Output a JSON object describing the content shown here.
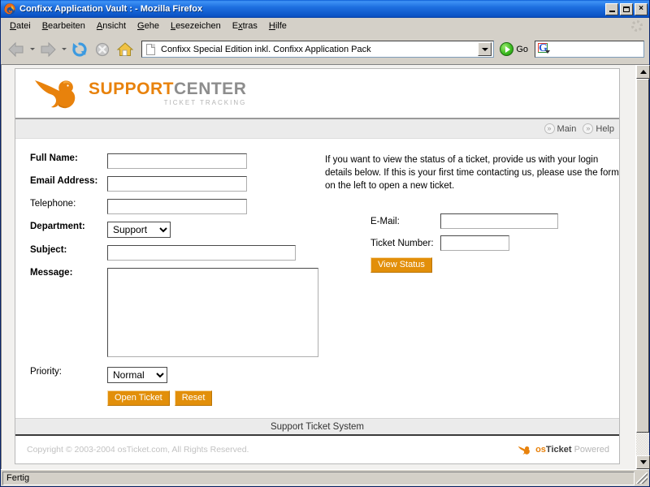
{
  "window": {
    "title": "Confixx Application Vault : - Mozilla Firefox",
    "app_icon": "firefox-icon",
    "minimize_label": "",
    "maximize_label": "",
    "close_label": "×"
  },
  "menubar": {
    "items": [
      {
        "label": "Datei",
        "accel": "D"
      },
      {
        "label": "Bearbeiten",
        "accel": "B"
      },
      {
        "label": "Ansicht",
        "accel": "A"
      },
      {
        "label": "Gehe",
        "accel": "G"
      },
      {
        "label": "Lesezeichen",
        "accel": "L"
      },
      {
        "label": "Extras",
        "accel": "x"
      },
      {
        "label": "Hilfe",
        "accel": "H"
      }
    ]
  },
  "toolbar": {
    "back_icon": "back-arrow-icon",
    "forward_icon": "forward-arrow-icon",
    "reload_icon": "reload-icon",
    "stop_icon": "stop-icon",
    "home_icon": "home-icon",
    "address_value": "Confixx Special Edition inkl. Confixx Application Pack",
    "address_placeholder": "",
    "go_label": "Go",
    "search_value": "",
    "search_placeholder": "",
    "search_engine_icon": "google-g-icon"
  },
  "page": {
    "logo": {
      "icon": "kangaroo-icon",
      "primary": "SUPPORT",
      "secondary": "CENTER",
      "tagline": "TICKET TRACKING"
    },
    "nav": [
      {
        "icon": "double-chevron-icon",
        "label": "Main"
      },
      {
        "icon": "double-chevron-icon",
        "label": "Help"
      }
    ],
    "new_ticket_form": {
      "fields": [
        {
          "label": "Full Name:",
          "required": true,
          "value": "",
          "placeholder": ""
        },
        {
          "label": "Email Address:",
          "required": true,
          "value": "",
          "placeholder": ""
        },
        {
          "label": "Telephone:",
          "required": false,
          "value": "",
          "placeholder": ""
        }
      ],
      "department_label": "Department:",
      "department_value": "Support",
      "department_options": [
        "Support"
      ],
      "subject_label": "Subject:",
      "subject_value": "",
      "message_label": "Message:",
      "message_value": "",
      "priority_label": "Priority:",
      "priority_value": "Normal",
      "priority_options": [
        "Normal"
      ],
      "submit_label": "Open Ticket",
      "reset_label": "Reset"
    },
    "status_form": {
      "intro": "If you want to view the status of a ticket, provide us with your login details below. If this is your first time contacting us, please use the form on the left to open a new ticket.",
      "email_label": "E-Mail:",
      "email_value": "",
      "ticket_label": "Ticket Number:",
      "ticket_value": "",
      "submit_label": "View Status"
    },
    "footer_bar": "Support Ticket System",
    "copyright": "Copyright © 2003-2004 osTicket.com, All Rights Reserved.",
    "powered": {
      "os": "os",
      "ticket": "Ticket",
      "suffix": " Powered",
      "icon": "kangaroo-icon"
    }
  },
  "statusbar": {
    "text": "Fertig"
  },
  "colors": {
    "accent_orange": "#e28f0a",
    "logo_orange": "#e8820c",
    "logo_gray": "#8d8d8d",
    "titlebar_blue": "#1e6fe0",
    "chrome_gray": "#d4d0c8",
    "nav_band": "#ebebeb"
  }
}
